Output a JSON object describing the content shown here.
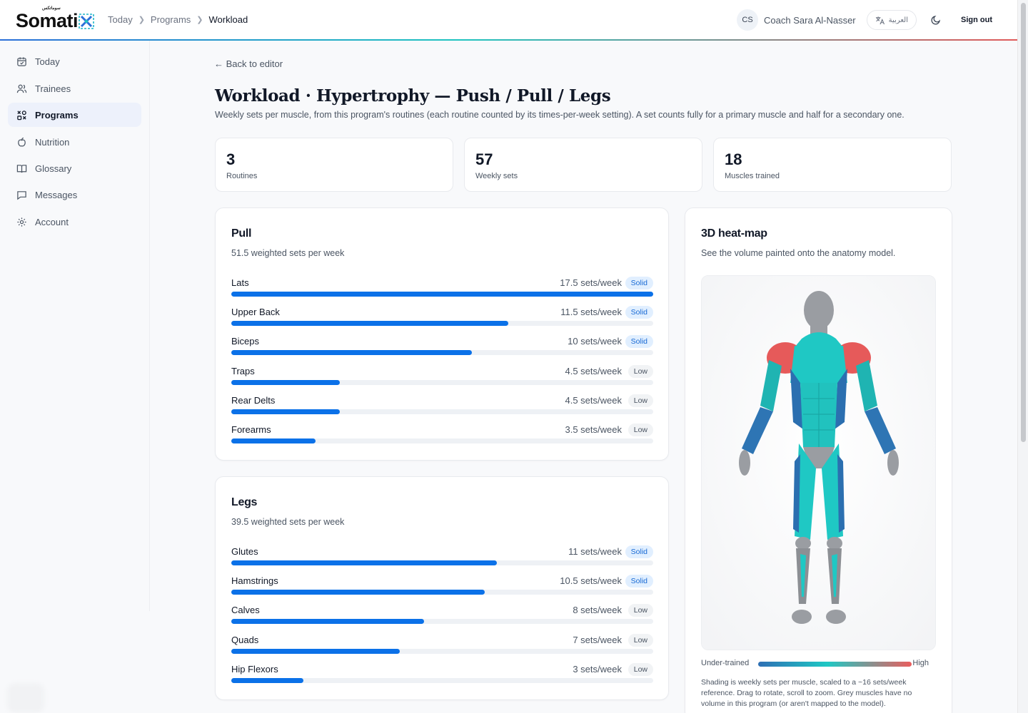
{
  "header": {
    "logo_text": "Somati",
    "logo_tag": "سوماتكس",
    "breadcrumb": [
      "Today",
      "Programs",
      "Workload"
    ],
    "coach_initials": "CS",
    "coach_name": "Coach Sara Al-Nasser",
    "language_label": "العربية",
    "signout_label": "Sign out"
  },
  "sidebar": {
    "items": [
      {
        "label": "Today",
        "icon": "calendar-icon"
      },
      {
        "label": "Trainees",
        "icon": "users-icon"
      },
      {
        "label": "Programs",
        "icon": "programs-icon",
        "active": true
      },
      {
        "label": "Nutrition",
        "icon": "apple-icon"
      },
      {
        "label": "Glossary",
        "icon": "book-icon"
      },
      {
        "label": "Messages",
        "icon": "message-icon"
      },
      {
        "label": "Account",
        "icon": "gear-icon"
      }
    ]
  },
  "main": {
    "back_link": "← Back to editor",
    "title": "Workload · Hypertrophy — Push / Pull / Legs",
    "subtitle": "Weekly sets per muscle, from this program's routines (each routine counted by its times-per-week setting). A set counts fully for a primary muscle and half for a secondary one.",
    "stats": [
      {
        "value": "3",
        "label": "Routines"
      },
      {
        "value": "57",
        "label": "Weekly sets"
      },
      {
        "value": "18",
        "label": "Muscles trained"
      }
    ],
    "groups": [
      {
        "title": "Pull",
        "subtitle": "51.5 weighted sets per week",
        "muscles": [
          {
            "name": "Lats",
            "sets": "17.5 sets/week",
            "badge": "Solid",
            "fill": 1.0
          },
          {
            "name": "Upper Back",
            "sets": "11.5 sets/week",
            "badge": "Solid",
            "fill": 0.657
          },
          {
            "name": "Biceps",
            "sets": "10 sets/week",
            "badge": "Solid",
            "fill": 0.571
          },
          {
            "name": "Traps",
            "sets": "4.5 sets/week",
            "badge": "Low",
            "fill": 0.257
          },
          {
            "name": "Rear Delts",
            "sets": "4.5 sets/week",
            "badge": "Low",
            "fill": 0.257
          },
          {
            "name": "Forearms",
            "sets": "3.5 sets/week",
            "badge": "Low",
            "fill": 0.2
          }
        ]
      },
      {
        "title": "Legs",
        "subtitle": "39.5 weighted sets per week",
        "muscles": [
          {
            "name": "Glutes",
            "sets": "11 sets/week",
            "badge": "Solid",
            "fill": 0.629
          },
          {
            "name": "Hamstrings",
            "sets": "10.5 sets/week",
            "badge": "Solid",
            "fill": 0.6
          },
          {
            "name": "Calves",
            "sets": "8 sets/week",
            "badge": "Low",
            "fill": 0.457
          },
          {
            "name": "Quads",
            "sets": "7 sets/week",
            "badge": "Low",
            "fill": 0.4
          },
          {
            "name": "Hip Flexors",
            "sets": "3 sets/week",
            "badge": "Low",
            "fill": 0.171
          }
        ]
      }
    ],
    "heatmap": {
      "title": "3D heat-map",
      "subtitle": "See the volume painted onto the anatomy model.",
      "legend_low": "Under-trained",
      "legend_high": "High",
      "note": "Shading is weekly sets per muscle, scaled to a ~16 sets/week reference. Drag to rotate, scroll to zoom. Grey muscles have no volume in this program (or aren't mapped to the model)."
    }
  },
  "colors": {
    "accent": "#0b71e8",
    "heat_low": "#2e6fb4",
    "heat_mid": "#1fc8c4",
    "heat_high": "#ea5d5d",
    "untrained": "#8a8d92"
  }
}
